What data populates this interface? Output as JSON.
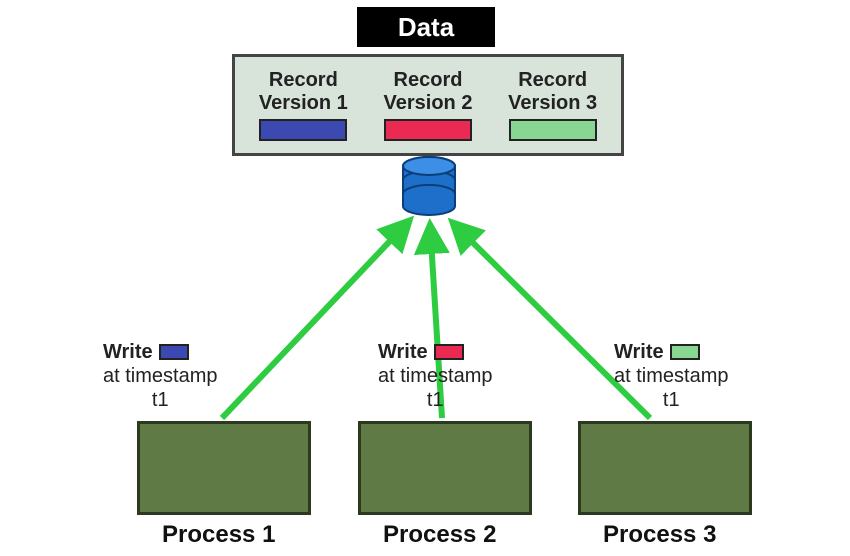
{
  "title": "Data",
  "records": [
    {
      "line1": "Record",
      "line2": "Version 1",
      "color": "#3b49b0"
    },
    {
      "line1": "Record",
      "line2": "Version 2",
      "color": "#ea2a53"
    },
    {
      "line1": "Record",
      "line2": "Version 3",
      "color": "#89d592"
    }
  ],
  "writes": [
    {
      "label": "Write",
      "timestamp_line1": "at timestamp",
      "timestamp_line2": "t1",
      "color": "#3b49b0"
    },
    {
      "label": "Write",
      "timestamp_line1": "at timestamp",
      "timestamp_line2": "t1",
      "color": "#ea2a53"
    },
    {
      "label": "Write",
      "timestamp_line1": "at timestamp",
      "timestamp_line2": "t1",
      "color": "#89d592"
    }
  ],
  "processes": [
    {
      "label": "Process 1"
    },
    {
      "label": "Process 2"
    },
    {
      "label": "Process 3"
    }
  ],
  "colors": {
    "arrow": "#2ecc40",
    "process_fill": "#5f7a44",
    "database": "#1565c0"
  }
}
